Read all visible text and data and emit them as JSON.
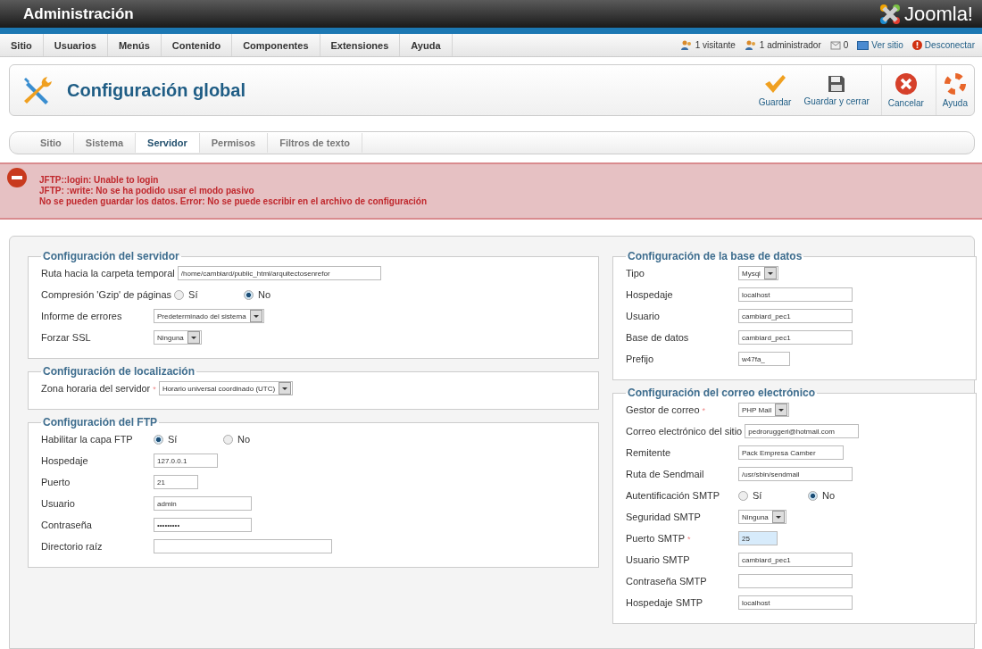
{
  "header": {
    "title": "Administración",
    "logo": "Joomla!"
  },
  "menu": [
    {
      "label": "Sitio"
    },
    {
      "label": "Usuarios"
    },
    {
      "label": "Menús"
    },
    {
      "label": "Contenido"
    },
    {
      "label": "Componentes"
    },
    {
      "label": "Extensiones"
    },
    {
      "label": "Ayuda"
    }
  ],
  "status": [
    {
      "kind": "visitors",
      "label": "1 visitante"
    },
    {
      "kind": "admins",
      "label": "1 administrador"
    },
    {
      "kind": "messages",
      "label": "0"
    },
    {
      "kind": "site",
      "label": "Ver sitio"
    },
    {
      "kind": "logout",
      "label": "Desconectar"
    }
  ],
  "toolbar": {
    "title": "Configuración global",
    "buttons": [
      {
        "kind": "save",
        "label": "Guardar"
      },
      {
        "kind": "save_close",
        "label": "Guardar y cerrar"
      },
      {
        "kind": "cancel",
        "label": "Cancelar"
      },
      {
        "kind": "help",
        "label": "Ayuda"
      }
    ]
  },
  "tabs": [
    {
      "label": "Sitio",
      "selected": false
    },
    {
      "label": "Sistema",
      "selected": false
    },
    {
      "label": "Servidor",
      "selected": true
    },
    {
      "label": "Permisos",
      "selected": false
    },
    {
      "label": "Filtros de texto",
      "selected": false
    }
  ],
  "errors": [
    "JFTP::login: Unable to login",
    "JFTP: :write: No se ha podido usar el modo pasivo",
    "No se pueden guardar los datos. Error: No se puede escribir en el archivo de configuración"
  ],
  "columns": [
    [
      {
        "title": "Configuración del servidor",
        "fields": [
          {
            "label": "Ruta hacia la carpeta temporal",
            "kind": "text",
            "value": "/home/cambiard/public_html/arquitectosenrefor",
            "focused": false
          },
          {
            "label": "Compresión 'Gzip' de páginas",
            "kind": "radio",
            "options": [
              {
                "label": "Sí",
                "selected": false
              },
              {
                "label": "No",
                "selected": true
              }
            ]
          },
          {
            "label": "Informe de errores",
            "kind": "select",
            "value": "Predeterminado del sistema"
          },
          {
            "label": "Forzar SSL",
            "kind": "select",
            "value": "Ninguna"
          }
        ]
      },
      {
        "title": "Configuración de localización",
        "fields": [
          {
            "label": "Zona horaria del servidor",
            "marker": "*",
            "kind": "select",
            "value": "Horario universal coordinado (UTC)"
          }
        ]
      },
      {
        "title": "Configuración del FTP",
        "fields": [
          {
            "label": "Habilitar la capa FTP",
            "kind": "radio",
            "options": [
              {
                "label": "Sí",
                "selected": true
              },
              {
                "label": "No",
                "selected": false
              }
            ]
          },
          {
            "label": "Hospedaje",
            "kind": "text",
            "value": "127.0.0.1",
            "focused": false
          },
          {
            "label": "Puerto",
            "kind": "text",
            "value": "21",
            "focused": false
          },
          {
            "label": "Usuario",
            "kind": "text",
            "value": "admin",
            "focused": false
          },
          {
            "label": "Contraseña",
            "kind": "password",
            "value": "•••••••••",
            "focused": false
          },
          {
            "label": "Directorio raíz",
            "kind": "text",
            "focused": false
          }
        ]
      }
    ],
    [
      {
        "title": "Configuración de la base de datos",
        "fields": [
          {
            "label": "Tipo",
            "kind": "select",
            "value": "Mysql"
          },
          {
            "label": "Hospedaje",
            "kind": "text",
            "value": "localhost",
            "focused": false
          },
          {
            "label": "Usuario",
            "kind": "text",
            "value": "cambiard_pec1",
            "focused": false
          },
          {
            "label": "Base de datos",
            "kind": "text",
            "value": "cambiard_pec1",
            "focused": false
          },
          {
            "label": "Prefijo",
            "kind": "text",
            "value": "w47fa_",
            "focused": false
          }
        ]
      },
      {
        "title": "Configuración del correo electrónico",
        "fields": [
          {
            "label": "Gestor de correo",
            "marker": "*",
            "kind": "select",
            "value": "PHP Mail"
          },
          {
            "label": "Correo electrónico del sitio",
            "kind": "text",
            "value": "pedroruggeri@hotmail.com",
            "focused": false
          },
          {
            "label": "Remitente",
            "kind": "text",
            "value": "Pack Empresa Camber",
            "focused": false
          },
          {
            "label": "Ruta de Sendmail",
            "kind": "text",
            "value": "/usr/sbin/sendmail",
            "focused": false
          },
          {
            "label": "Autentificación SMTP",
            "kind": "radio",
            "options": [
              {
                "label": "Sí",
                "selected": false
              },
              {
                "label": "No",
                "selected": true
              }
            ]
          },
          {
            "label": "Seguridad SMTP",
            "kind": "select",
            "value": "Ninguna"
          },
          {
            "label": "Puerto SMTP",
            "marker": "*",
            "kind": "text",
            "value": "25",
            "focused": true
          },
          {
            "label": "Usuario SMTP",
            "kind": "text",
            "value": "cambiard_pec1",
            "focused": false
          },
          {
            "label": "Contraseña SMTP",
            "kind": "password",
            "focused": false
          },
          {
            "label": "Hospedaje SMTP",
            "kind": "text",
            "value": "localhost",
            "focused": false
          }
        ]
      }
    ]
  ]
}
